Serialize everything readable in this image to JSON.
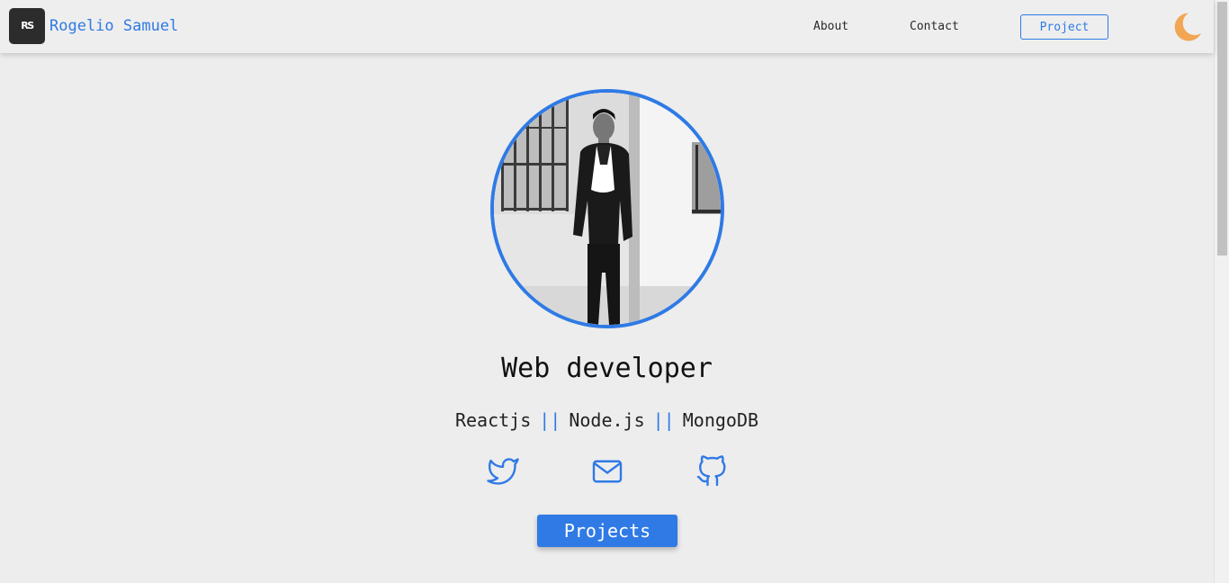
{
  "navbar": {
    "logo_text": "RS",
    "brand_name": "Rogelio Samuel",
    "links": [
      {
        "label": "About"
      },
      {
        "label": "Contact"
      }
    ],
    "project_button_label": "Project",
    "theme_icon": "moon-icon"
  },
  "hero": {
    "avatar_icon": "profile-photo",
    "headline": "Web developer",
    "stack": [
      "Reactjs",
      "Node.js",
      "MongoDB"
    ],
    "separator": "||",
    "social_icons": [
      "twitter-icon",
      "mail-icon",
      "github-icon"
    ],
    "projects_button_label": "Projects"
  },
  "colors": {
    "accent": "#2f7ae5",
    "background": "#ededed",
    "moon": "#f2a654",
    "logo_bg": "#2c2c2c"
  }
}
